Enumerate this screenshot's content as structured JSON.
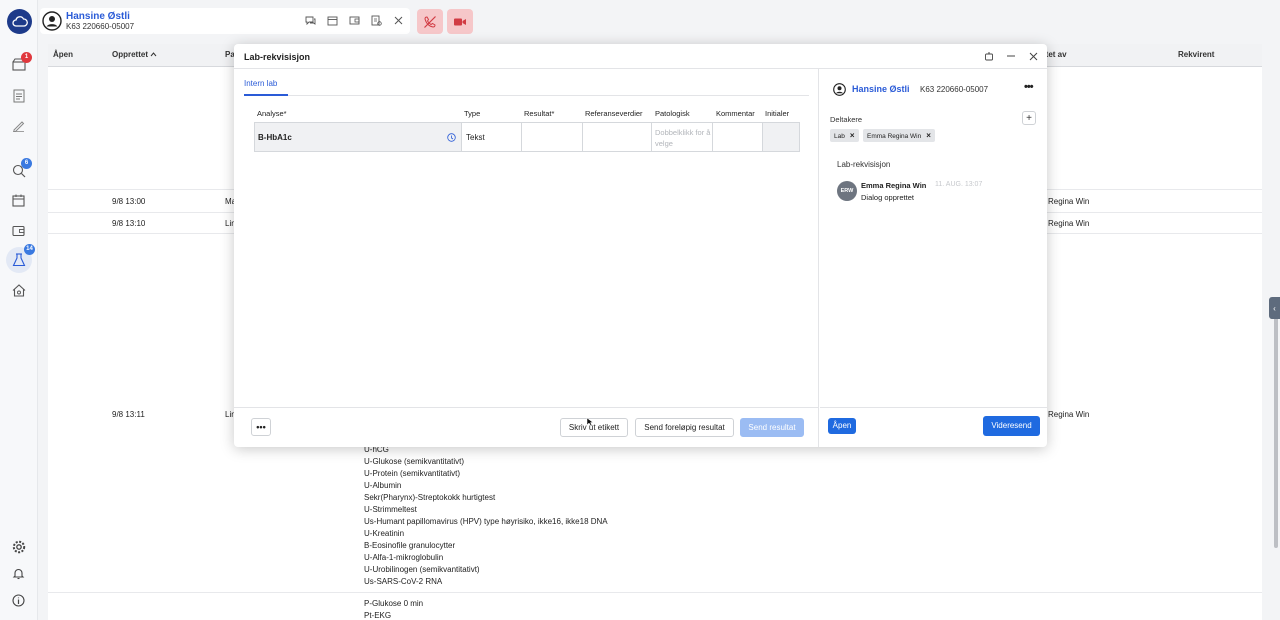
{
  "sidebar": {
    "badges": {
      "archive": "1",
      "chat": "6",
      "lab": "14"
    }
  },
  "topbar": {
    "patient_name": "Hansine Østli",
    "patient_id": "K63 220660-05007"
  },
  "table": {
    "headers": [
      "Åpen",
      "Opprettet",
      "Pa",
      "ttet av",
      "Rekvirent"
    ],
    "rows": [
      {
        "time": "9/8 13:00",
        "patient": "Ma",
        "by": "Regina Win"
      },
      {
        "time": "9/8 13:10",
        "patient": "Lin",
        "by": "Regina Win"
      },
      {
        "time": "9/8 13:11",
        "patient": "Lin",
        "by": "Regina Win"
      }
    ],
    "analysis_list": [
      "U-hCG",
      "U-Glukose (semikvantitativt)",
      "U-Protein (semikvantitativt)",
      "U-Albumin",
      "Sekr(Pharynx)-Streptokokk hurtigtest",
      "U-Strimmeltest",
      "Us-Humant papillomavirus (HPV) type høyrisiko, ikke16, ikke18 DNA",
      "U-Kreatinin",
      "B-Eosinofile granulocytter",
      "U-Alfa-1-mikroglobulin",
      "U-Urobilinogen (semikvantitativt)",
      "Us-SARS-CoV-2 RNA"
    ],
    "next_list": [
      "P-Glukose 0 min",
      "Pt-EKG"
    ]
  },
  "dialog": {
    "title": "Lab-rekvisisjon",
    "tab": "Intern lab",
    "columns": [
      "Analyse*",
      "Type",
      "Resultat*",
      "Referanseverdier",
      "Patologisk",
      "Kommentar",
      "Initialer"
    ],
    "row": {
      "analyse": "B-HbA1c",
      "type": "Tekst",
      "patologisk_hint": "Dobbelklikk for å velge"
    },
    "buttons": {
      "print": "Skriv ut etikett",
      "prelim": "Send foreløpig resultat",
      "send": "Send resultat"
    },
    "right": {
      "patient_name": "Hansine Østli",
      "patient_id": "K63 220660-05007",
      "participants_label": "Deltakere",
      "chips": [
        "Lab",
        "Emma Regina Win"
      ],
      "section": "Lab-rekvisisjon",
      "avatar_initials": "ERW",
      "author": "Emma Regina Win",
      "time": "11. AUG. 13:07",
      "message": "Dialog opprettet",
      "open_button": "Åpen",
      "forward_button": "Videresend"
    }
  }
}
